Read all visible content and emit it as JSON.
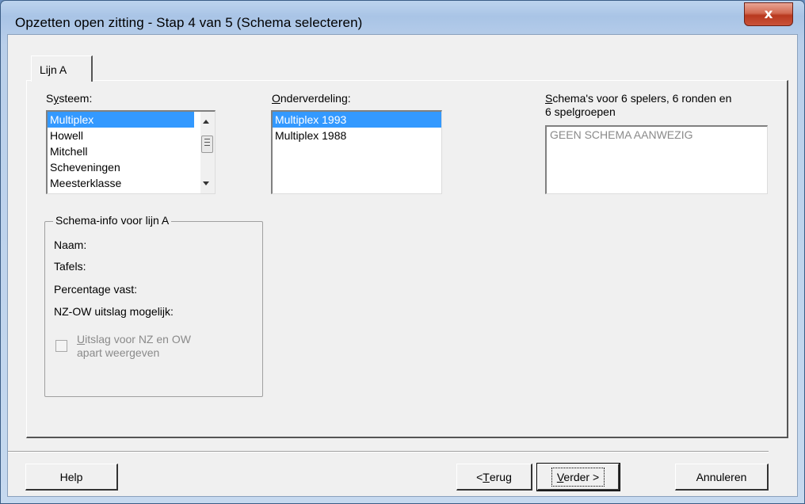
{
  "window": {
    "title": "Opzetten open zitting - Stap 4 van 5 (Schema selecteren)",
    "close_glyph": "x"
  },
  "tabs": [
    {
      "label": "Lijn A",
      "selected": true
    }
  ],
  "systeem": {
    "label_pre": "S",
    "label_u": "y",
    "label_post": "steem:",
    "items": [
      "Multiplex",
      "Howell",
      "Mitchell",
      "Scheveningen",
      "Meesterklasse"
    ],
    "selected_index": 0
  },
  "onderverdeling": {
    "label_u": "O",
    "label_post": "nderverdeling:",
    "items": [
      "Multiplex 1993",
      "Multiplex 1988"
    ],
    "selected_index": 0
  },
  "schemas": {
    "label_u": "S",
    "label_line1_post": "chema's voor 6 spelers, 6 ronden en",
    "label_line2": "6 spelgroepen",
    "items": [
      "GEEN SCHEMA AANWEZIG"
    ]
  },
  "schema_info": {
    "legend": "Schema-info voor lijn A",
    "naam": "Naam:",
    "tafels": "Tafels:",
    "percentage_vast": "Percentage vast:",
    "nzow": "NZ-OW uitslag mogelijk:",
    "checkbox_u": "U",
    "checkbox_line1_post": "itslag voor NZ en OW",
    "checkbox_line2": "apart weergeven",
    "checkbox_checked": false,
    "checkbox_enabled": false
  },
  "buttons": {
    "help": "Help",
    "back_pre": "< ",
    "back_u": "T",
    "back_post": "erug",
    "next_u": "V",
    "next_post": "erder >",
    "cancel": "Annuleren"
  },
  "colors": {
    "selection": "#3399ff",
    "dialog_bg": "#f0f0f0",
    "close_button": "#c9523a"
  }
}
